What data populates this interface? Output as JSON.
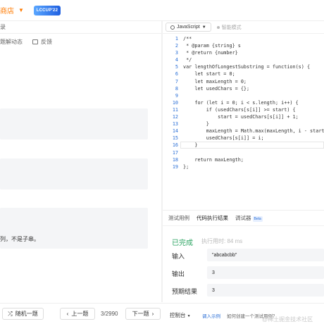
{
  "topbar": {
    "shop_label": "商店",
    "contest_badge": "LCCUP'22"
  },
  "left": {
    "tab_fragment": "录",
    "action_solution_news": "题解动态",
    "action_feedback": "反馈",
    "example_text": "列，不是子串。"
  },
  "editor": {
    "language": "JavaScript",
    "smart_mode": "智能模式",
    "lines": [
      {
        "n": "1",
        "t": "/**"
      },
      {
        "n": "2",
        "t": " * @param {string} s"
      },
      {
        "n": "3",
        "t": " * @return {number}"
      },
      {
        "n": "4",
        "t": " */"
      },
      {
        "n": "5",
        "t": "var lengthOfLongestSubstring = function(s) {"
      },
      {
        "n": "6",
        "t": "    let start = 0;"
      },
      {
        "n": "7",
        "t": "    let maxLength = 0;"
      },
      {
        "n": "8",
        "t": "    let usedChars = {};"
      },
      {
        "n": "9",
        "t": ""
      },
      {
        "n": "10",
        "t": "    for (let i = 0; i < s.length; i++) {"
      },
      {
        "n": "11",
        "t": "        if (usedChars[s[i]] >= start) {"
      },
      {
        "n": "12",
        "t": "            start = usedChars[s[i]] + 1;"
      },
      {
        "n": "13",
        "t": "        }"
      },
      {
        "n": "14",
        "t": "        maxLength = Math.max(maxLength, i - start"
      },
      {
        "n": "15",
        "t": "        usedChars[s[i]] = i;"
      },
      {
        "n": "16",
        "t": "    }"
      },
      {
        "n": "17",
        "t": ""
      },
      {
        "n": "18",
        "t": "    return maxLength;"
      },
      {
        "n": "19",
        "t": "};"
      }
    ]
  },
  "testpanel": {
    "tabs": [
      "测试用例",
      "代码执行结果",
      "调试器"
    ],
    "beta": "Beta",
    "status": "已完成",
    "exec_time": "执行用时: 84 ms",
    "input_label": "输入",
    "input_value": "\"abcabcbb\"",
    "output_label": "输出",
    "output_value": "3",
    "expected_label": "预期结果",
    "expected_value": "3"
  },
  "bottombar": {
    "random_label": "随机一题",
    "prev_label": "上一题",
    "pager": "3/2990",
    "next_label": "下一题",
    "console_label": "控制台",
    "run_example": "调入示例",
    "how_to": "如何创建一个测试用例？",
    "watermark": "@稀土掘金技术社区"
  }
}
